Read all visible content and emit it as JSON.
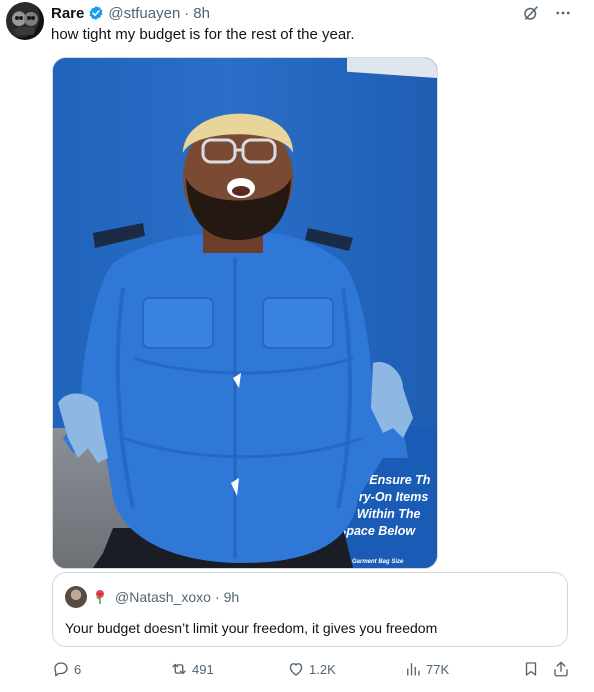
{
  "author": {
    "name": "Rare",
    "handle": "@stfuayen",
    "separator": "·",
    "time": "8h",
    "verified": true
  },
  "tweet": {
    "text": "how tight my budget is for the rest of the year."
  },
  "media": {
    "sign_lines": [
      "ease Ensure Th",
      "Carry-On Items",
      "Fit Within The",
      "Space Below"
    ],
    "sign_small": "ided Garment Bag Size"
  },
  "quote": {
    "handle": "@Natash_xoxo",
    "separator": "·",
    "time": "9h",
    "text": "Your budget doesn’t limit your freedom, it gives you freedom"
  },
  "actions": {
    "replies": "6",
    "reposts": "491",
    "likes": "1.2K",
    "views": "77K"
  },
  "icons": {
    "header": [
      "grok-icon",
      "more-icon"
    ],
    "actions": [
      "reply-icon",
      "repost-icon",
      "like-icon",
      "views-icon",
      "bookmark-icon",
      "share-icon"
    ]
  },
  "colors": {
    "text": "#0f1419",
    "secondary": "#536471",
    "verified": "#1d9bf0",
    "border": "#cfd9de"
  }
}
